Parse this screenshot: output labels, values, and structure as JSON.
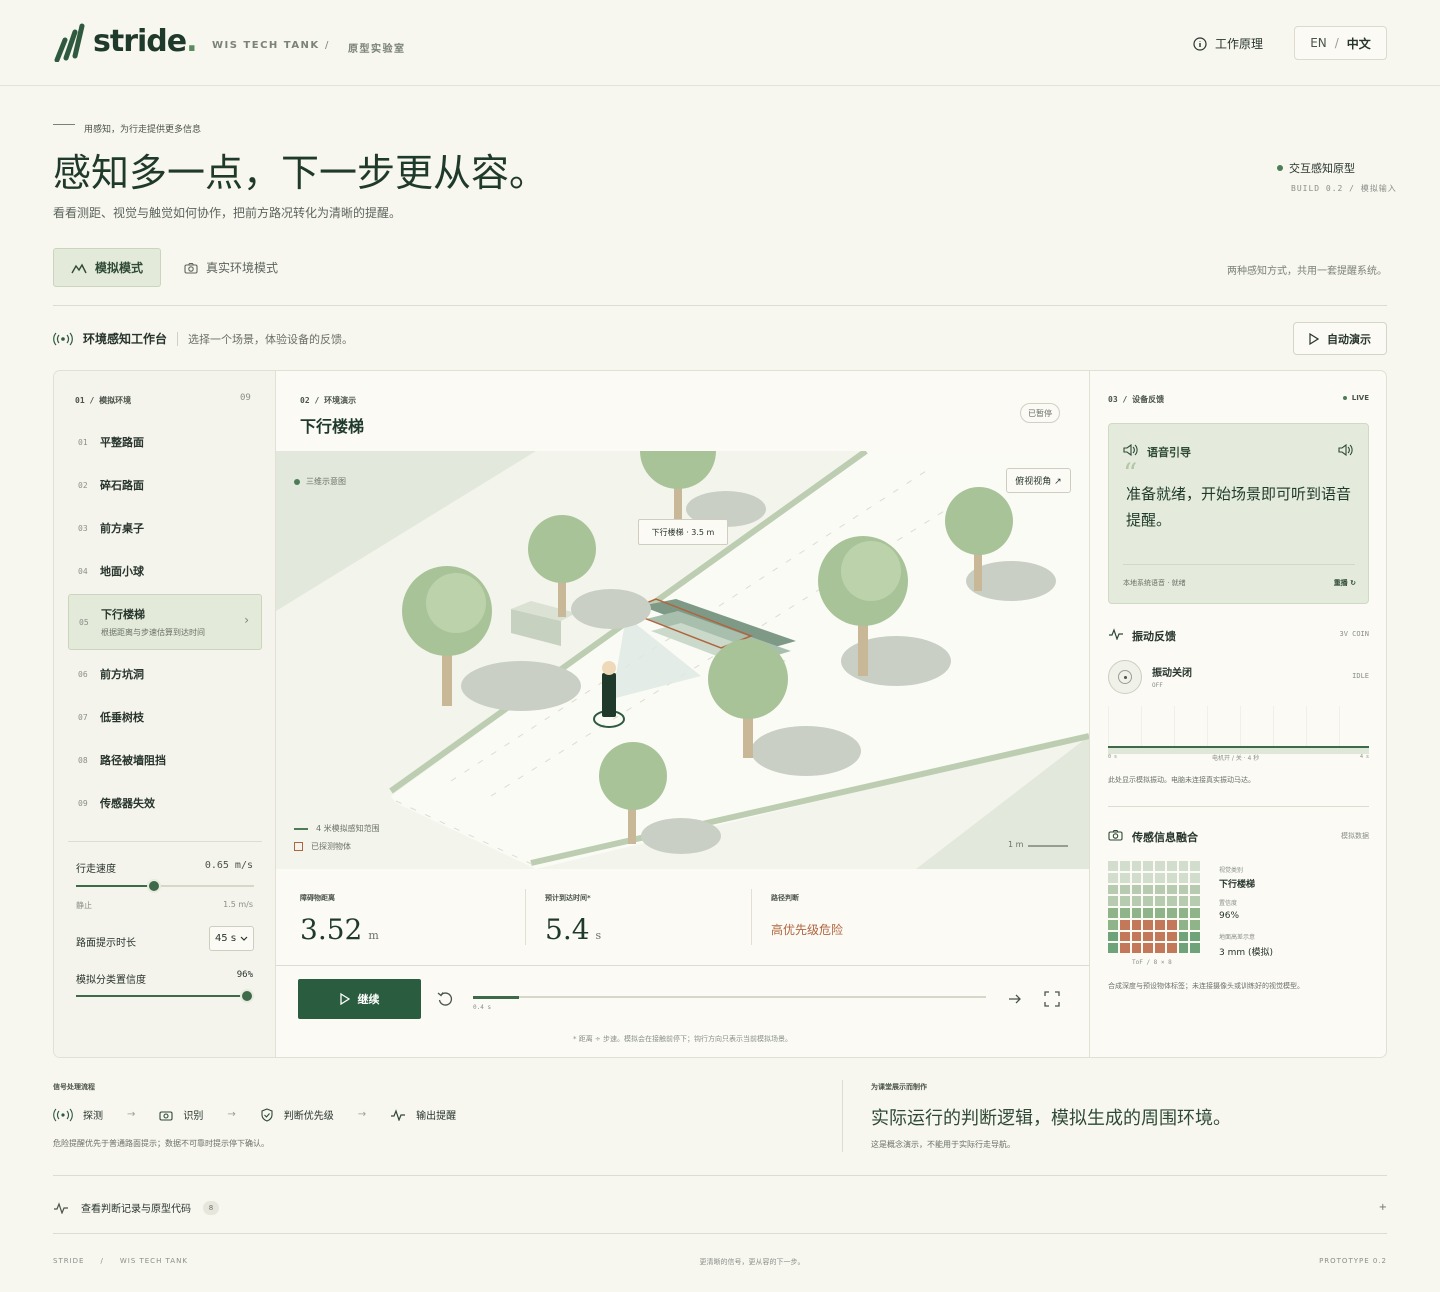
{
  "brand": {
    "name": "stride",
    "org": "WIS TECH TANK",
    "sep": "/",
    "lab": "原型实验室"
  },
  "nav": {
    "how": "工作原理",
    "lang_en": "EN",
    "lang_sep": "/",
    "lang_zh": "中文"
  },
  "hero": {
    "eyebrow": "用感知，为行走提供更多信息",
    "title": "感知多一点，下一步更从容。",
    "subtitle": "看看测距、视觉与触觉如何协作，把前方路况转化为清晰的提醒。",
    "status": "交互感知原型",
    "build": "BUILD 0.2 / 模拟输入"
  },
  "modes": {
    "sim": "模拟模式",
    "real": "真实环境模式",
    "note": "两种感知方式，共用一套提醒系统。"
  },
  "workbench": {
    "title": "环境感知工作台",
    "hint": "选择一个场景，体验设备的反馈。",
    "auto": "自动演示"
  },
  "scenes": {
    "header": "01 / 模拟环境",
    "count": "09",
    "items": [
      {
        "n": "01",
        "label": "平整路面"
      },
      {
        "n": "02",
        "label": "碎石路面"
      },
      {
        "n": "03",
        "label": "前方桌子"
      },
      {
        "n": "04",
        "label": "地面小球"
      },
      {
        "n": "05",
        "label": "下行楼梯",
        "desc": "根据距离与步速估算到达时间"
      },
      {
        "n": "06",
        "label": "前方坑洞"
      },
      {
        "n": "07",
        "label": "低垂树枝"
      },
      {
        "n": "08",
        "label": "路径被墙阻挡"
      },
      {
        "n": "09",
        "label": "传感器失效"
      }
    ]
  },
  "controls": {
    "speed_label": "行走速度",
    "speed_value": "0.65 m/s",
    "speed_min": "静止",
    "speed_max": "1.5 m/s",
    "speed_frac": 0.44,
    "duration_label": "路面提示时长",
    "duration_value": "45 s",
    "conf_label": "模拟分类置信度",
    "conf_value": "96%",
    "conf_frac": 0.96
  },
  "scene": {
    "header": "02 / 环境演示",
    "title": "下行楼梯",
    "state": "已暂停",
    "layer": "三维示意图",
    "view": "俯视视角 ↗",
    "callout": "下行楼梯 · 3.5 m",
    "legend_range": "4 米模拟感知范围",
    "legend_obj": "已探测物体",
    "scale": "1 m"
  },
  "metrics": {
    "dist_label": "障碍物距离",
    "dist_value": "3.52",
    "dist_unit": "m",
    "eta_label": "预计到达时间",
    "eta_sup": "*",
    "eta_value": "5.4",
    "eta_unit": "s",
    "judge_label": "路径判断",
    "judge_value": "高优先级危险"
  },
  "player": {
    "play": "继续",
    "time": "0.4 s",
    "progress": 0.09,
    "footnote": "* 距离 ÷ 步速。模拟会在接触前停下；钩行方向只表示当前模拟场景。"
  },
  "feedback": {
    "header": "03 / 设备反馈",
    "live": "LIVE",
    "voice_title": "语音引导",
    "voice_text": "准备就绪，开始场景即可听到语音提醒。",
    "voice_src": "本地系统语音 · 就绪",
    "replay": "重播 ↻",
    "vib_title": "振动反馈",
    "vib_tag": "3V COIN",
    "vib_state": "振动关闭",
    "vib_off": "OFF",
    "vib_idle": "IDLE",
    "vib_x0": "0 s",
    "vib_xm": "电机开 / 关 · 4 秒",
    "vib_x1": "4 s",
    "vib_note": "此处显示模拟振动。电脑未连接真实振动马达。",
    "fusion_title": "传感信息融合",
    "fusion_tag": "模拟数据",
    "grid_label": "ToF / 8 × 8",
    "cls_label": "视觉类别",
    "cls_value": "下行楼梯",
    "conf_label": "置信度",
    "conf_value": "96%",
    "surf_label": "地面高差示意",
    "surf_value": "3 mm (模拟)",
    "fusion_note": "合成深度与预设物体标签；未连接摄像头或训练好的视觉模型。"
  },
  "pipeline": {
    "title": "信号处理流程",
    "steps": [
      "探测",
      "识别",
      "判断优先级",
      "输出提醒"
    ],
    "arrow": "→",
    "note": "危险提醒优先于普通路面提示；数据不可靠时提示停下确认。",
    "class_label": "为课堂展示而制作",
    "class_text": "实际运行的判断逻辑，模拟生成的周围环境。",
    "class_note": "这是概念演示，不能用于实际行走导航。"
  },
  "log": {
    "label": "查看判断记录与原型代码",
    "count": "8",
    "plus": "+"
  },
  "footer": {
    "left1": "STRIDE",
    "sep": "/",
    "left2": "WIS TECH TANK",
    "center": "更清晰的信号，更从容的下一步。",
    "right": "PROTOTYPE 0.2"
  },
  "colors": {
    "accent": "#2f5a40",
    "danger": "#b0653f",
    "panel": "#e3ead9"
  }
}
